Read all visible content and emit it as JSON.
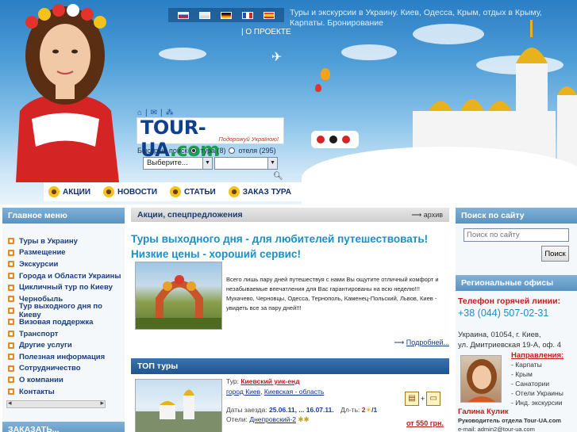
{
  "header": {
    "tagline": "Туры и экскурсии в Украину. Киев, Одесса, Крым, отдых в Крыму, Карпаты. Бронирование",
    "about_link": "| О ПРОЕКТЕ",
    "logo_text": "TOUR-UA",
    "logo_domain": ".com",
    "logo_slogan": "Подорожуй Україною!",
    "quick_search_label": "Быстрый поиск",
    "radio_tours": "тура (8)",
    "radio_hotels": "отеля (295)",
    "select_placeholder": "Выберите..."
  },
  "flags": [
    "ru-flag-icon",
    "ua-flag-icon",
    "de-flag-icon",
    "fr-flag-icon",
    "es-flag-icon"
  ],
  "topnav": [
    "АКЦИИ",
    "НОВОСТИ",
    "СТАТЬИ",
    "ЗАКАЗ ТУРА"
  ],
  "left_menu": {
    "title": "Главное меню",
    "items": [
      "Туры в Украину",
      "Размещение",
      "Экскурсии",
      "Города и Области Украины",
      "Цикличный тур по Киеву",
      "Чернобыль",
      "Тур выходного дня по Киеву",
      "Визовая поддержка",
      "Транспорт",
      "Другие услуги",
      "Полезная информация",
      "Сотрудничество",
      "О компании",
      "Контакты"
    ],
    "order_title": "ЗАКАЗАТЬ..."
  },
  "promo": {
    "header": "Акции, спецпредложения",
    "archive": "архив",
    "title": "Туры выходного дня - для любителей путешествовать! Низкие цены - хороший сервис!",
    "text": "Всего лишь пару дней путешествуя с нами Вы ощутите отличный комфорт и незабываемые впечатления для Вас гарантированы на всю неделю!!! Мукачево, Черновцы, Одесса, Тернополь, Каменец-Польский, Львов, Киев - увидеть все за пару дней!!!",
    "more": "Подробней..."
  },
  "top_tours": {
    "header": "ТОП туры",
    "tour_label": "Тур:",
    "tour_name": "Киевский уик-енд",
    "city": "город Киев",
    "region": "Киевская - область",
    "dates_label": "Даты заезда:",
    "dates": "25.06.11, ... 16.07.11.",
    "duration_label": "Дл-ть:",
    "duration": "2",
    "duration_rest": "/1",
    "hotels_label": "Отели:",
    "hotel": "Днепровский-2",
    "price": "от 550 грн."
  },
  "right": {
    "search_title": "Поиск по сайту",
    "search_placeholder": "Поиск по сайту",
    "search_button": "Поиск",
    "regions_title": "Региональные офисы",
    "hotline_label": "Телефон горячей линии:",
    "hotline_number": "+38 (044) 507-02-31",
    "address_1": "Украина, 01054, г. Киев,",
    "address_2": "ул. Дмитриевская 19-А, оф. 4",
    "directions_title": "Направления:",
    "directions": [
      "- Карпаты",
      "- Крым",
      "- Санатории",
      "- Отели Украины",
      "- Инд. экскурсии"
    ],
    "manager_name": "Галина Кулик",
    "manager_role": "Руководитель отдела Tour-UA.com",
    "manager_email": "e-mail: admin2@tour-ua.com"
  },
  "colors": {
    "accent": "#1c8fc4",
    "nav_blue": "#1f5592",
    "alert_red": "#c41b1b",
    "menu_bullet": "#e58a1f"
  }
}
